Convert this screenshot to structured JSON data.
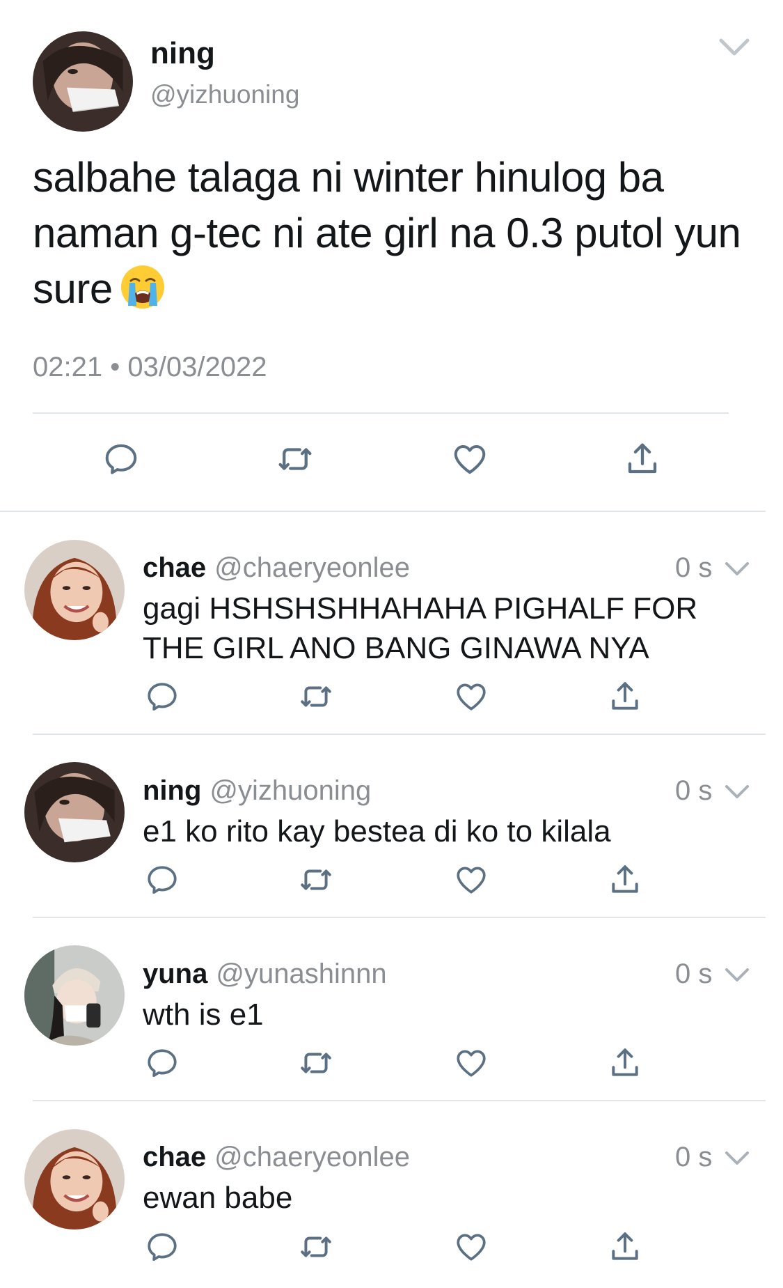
{
  "main_tweet": {
    "display_name": "ning",
    "handle": "@yizhuoning",
    "text": "salbahe talaga ni winter hinulog ba naman g-tec ni ate girl na 0.3 putol yun sure",
    "emoji": "loudly-crying-face",
    "timestamp": "02:21 • 03/03/2022",
    "icons": [
      "reply-icon",
      "retweet-icon",
      "like-icon",
      "share-icon"
    ],
    "menu_icon": "chevron-down-icon"
  },
  "replies": [
    {
      "display_name": "chae",
      "handle": "@chaeryeonlee",
      "time": "0 s",
      "text": "gagi HSHSHSHHAHAHA PIGHALF FOR THE GIRL ANO BANG GINAWA NYA"
    },
    {
      "display_name": "ning",
      "handle": "@yizhuoning",
      "time": "0 s",
      "text": "e1 ko rito kay bestea di ko to kilala"
    },
    {
      "display_name": "yuna",
      "handle": "@yunashinnn",
      "time": "0 s",
      "text": "wth is e1"
    },
    {
      "display_name": "chae",
      "handle": "@chaeryeonlee",
      "time": "0 s",
      "text": "ewan babe"
    }
  ],
  "colors": {
    "text_primary": "#14171a",
    "text_secondary": "#8a8d91",
    "icon": "#5b7083",
    "divider": "#e3e6e8",
    "background": "#ffffff"
  }
}
